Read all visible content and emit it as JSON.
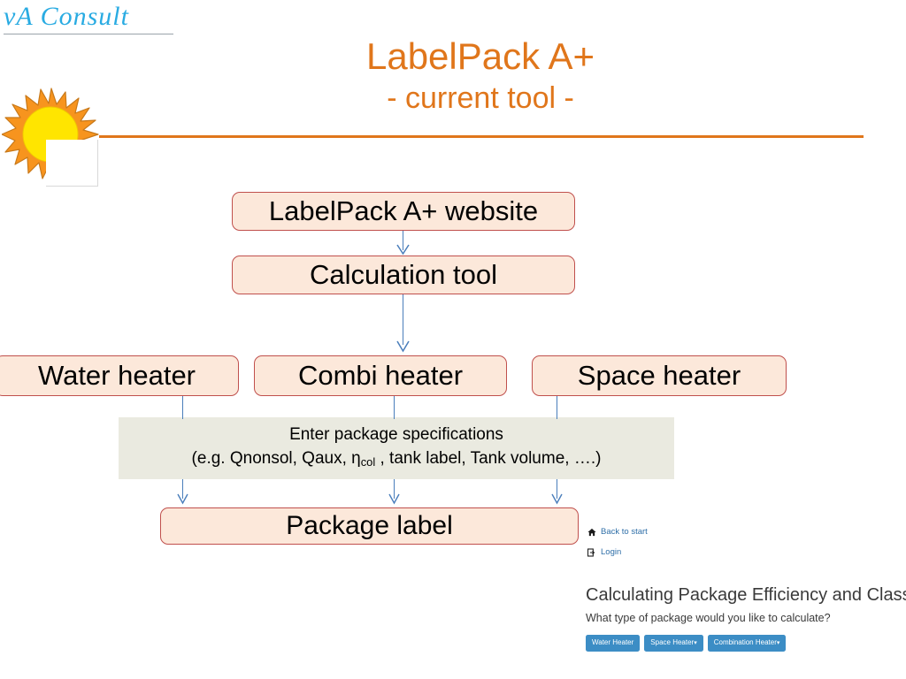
{
  "logo": {
    "text": "vA Consult",
    "color": "#29ABE2"
  },
  "header": {
    "title": "LabelPack A+",
    "subtitle": "- current tool -",
    "accent_color": "#E0761B"
  },
  "flowchart": {
    "box_fill": "#FCE8DA",
    "box_border": "#C0504D",
    "connector_color": "#4A7EBB",
    "nodes": {
      "website": "LabelPack A+ website",
      "calculation_tool": "Calculation tool",
      "water_heater": "Water heater",
      "combi_heater": "Combi heater",
      "space_heater": "Space heater",
      "package_label": "Package label"
    },
    "specifications": {
      "fill": "#EAEAE0",
      "line1": "Enter package specifications",
      "line2_prefix": "(e.g. Qnonsol, Qaux, η",
      "line2_sub": "col",
      "line2_suffix": " , tank label, Tank volume, ….)"
    }
  },
  "web_capture": {
    "nav": {
      "back_label": "Back to start",
      "login_label": "Login"
    },
    "heading": "Calculating Package Efficiency and Class",
    "question": "What type of package would you like to calculate?",
    "button_color": "#3C8DC5",
    "buttons": [
      {
        "label": "Water Heater",
        "caret": ""
      },
      {
        "label": "Space Heater",
        "caret": "▾"
      },
      {
        "label": "Combination Heater",
        "caret": "▾"
      }
    ]
  }
}
